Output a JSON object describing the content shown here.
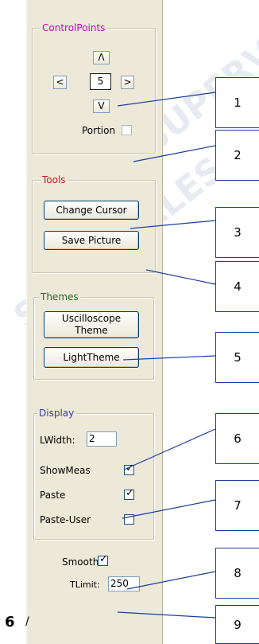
{
  "control_points": {
    "title": "ControlPoints",
    "title_color": "#cc00cc",
    "up_arrow": "Λ",
    "left_arrow": "<",
    "value": "5",
    "right_arrow": ">",
    "down_arrow": "V",
    "portion_label": "Portion"
  },
  "tools": {
    "title": "Tools",
    "title_color": "#cc2020",
    "change_cursor": "Change Cursor",
    "save_picture": "Save Picture"
  },
  "themes": {
    "title": "Themes",
    "title_color": "#2a6a2a",
    "oscilloscope_line1": "Uscilloscope",
    "oscilloscope_line2": "Theme",
    "light_theme": "LightTheme"
  },
  "display": {
    "title": "Display",
    "title_color": "#3a3aa8",
    "lwidth_label": "LWidth:",
    "lwidth_value": "2",
    "showmeas_label": "ShowMeas",
    "showmeas_checked": true,
    "paste_label": "Paste",
    "paste_checked": true,
    "paste_user_label": "Paste-User",
    "paste_user_checked": false
  },
  "smooth": {
    "label": "Smooth",
    "checked": true
  },
  "tlimit": {
    "label": "TLimit:",
    "value": "250"
  },
  "callouts": [
    "1",
    "2",
    "3",
    "4",
    "5",
    "6",
    "7",
    "8",
    "9"
  ],
  "page_number": "6",
  "page_slash": "/"
}
